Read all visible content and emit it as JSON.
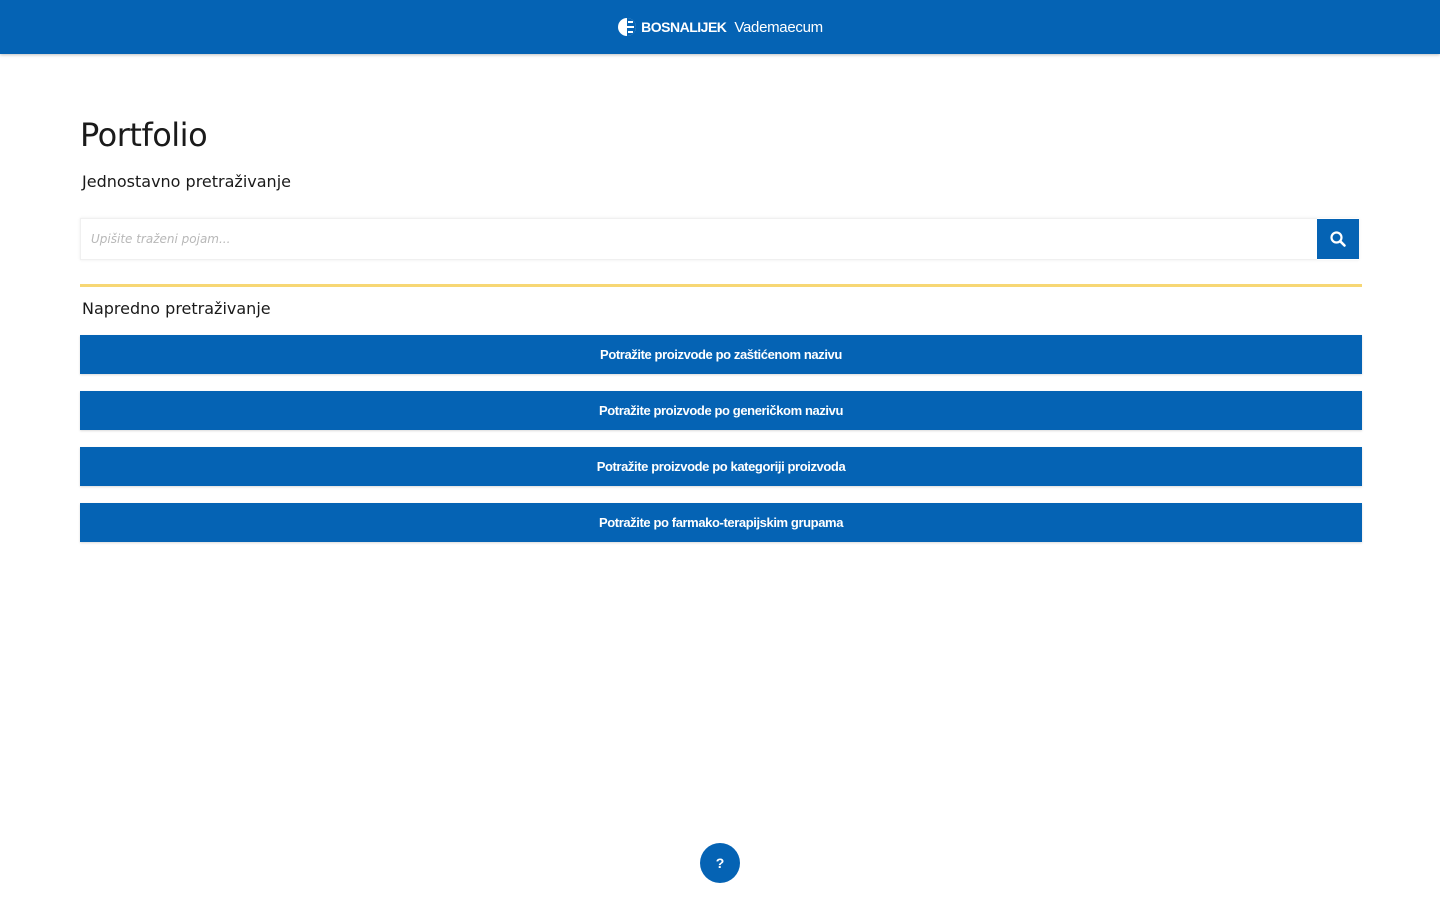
{
  "header": {
    "brand_name": "BOSNALIJEK",
    "product_name": "Vademaecum",
    "logo_icon": "bosnalijek-logo-icon"
  },
  "main": {
    "title": "Portfolio",
    "simple_search": {
      "label": "Jednostavno pretraživanje",
      "placeholder": "Upišite traženi pojam...",
      "value": "",
      "button_icon": "search-icon"
    },
    "advanced_search": {
      "label": "Napredno pretraživanje",
      "buttons": [
        {
          "label": "Potražite proizvode po zaštićenom nazivu"
        },
        {
          "label": "Potražite proizvode po generičkom nazivu"
        },
        {
          "label": "Potražite proizvode po kategoriji proizvoda"
        },
        {
          "label": "Potražite po farmako-terapijskim grupama"
        }
      ]
    }
  },
  "help": {
    "label": "?",
    "icon": "help-icon"
  },
  "colors": {
    "primary": "#0563b4",
    "divider": "#f7d774",
    "background": "#ffffff"
  }
}
